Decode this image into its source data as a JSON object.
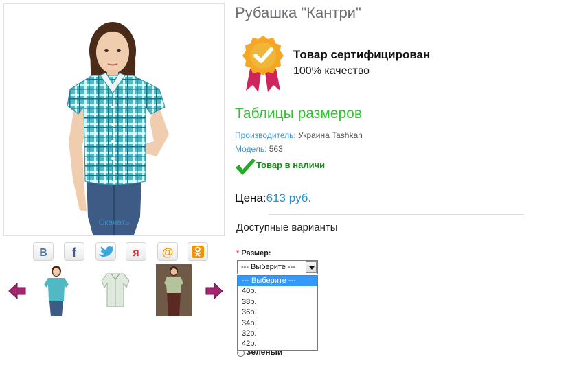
{
  "gallery": {
    "download_label": "Скачать"
  },
  "share": {
    "buttons": [
      {
        "name": "vk",
        "letter": "B",
        "color": "#4c75a3"
      },
      {
        "name": "facebook",
        "letter": "f",
        "color": "#3b5998"
      },
      {
        "name": "twitter",
        "letter": "",
        "color": "#3aa8dc"
      },
      {
        "name": "yandex",
        "letter": "я",
        "color": "#e8242a"
      },
      {
        "name": "mailru",
        "letter": "@",
        "color": "#f29400"
      },
      {
        "name": "odnoklassniki",
        "letter": "",
        "color": "#f29400"
      }
    ]
  },
  "product": {
    "title": "Рубашка \"Кантри\"",
    "certified_title": "Товар сертифицирован",
    "certified_subtitle": "100% качество",
    "size_tables_link": "Таблицы размеров",
    "manufacturer_label": "Производитель:",
    "manufacturer_value": "Украина Tashkan",
    "model_label": "Модель:",
    "model_value": "563",
    "stock_status": "Товар в наличи",
    "price_label": "Цена:",
    "price_value": "613 руб."
  },
  "options": {
    "heading": "Доступные варианты",
    "size_required_mark": "*",
    "size_label": "Размер:",
    "size_selected": "--- Выберите ---",
    "size_options": [
      "--- Выберите ---",
      "40р.",
      "38р.",
      "36р.",
      "34р.",
      "32р.",
      "42р."
    ],
    "color_option": "Зеленый"
  },
  "colors": {
    "accent_blue": "#2a8fc7",
    "link_green": "#2fc42f",
    "stock_green": "#1a8a1a",
    "arrow_purple": "#a0246e",
    "badge_gold": "#f5a623",
    "ribbon_red": "#d0245c"
  }
}
